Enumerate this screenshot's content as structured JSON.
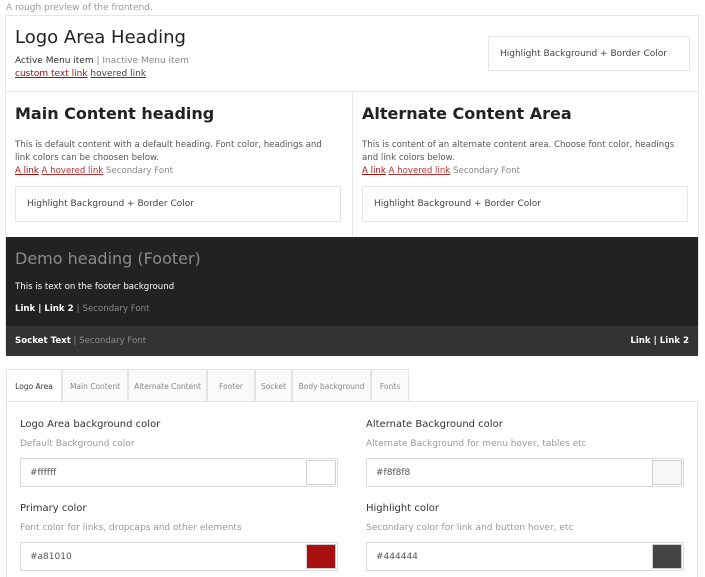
{
  "caption": "A rough preview of the frontend.",
  "logo_area": {
    "heading": "Logo Area Heading",
    "active_menu": "Active Menu item",
    "separator": "|",
    "inactive_menu": "Inactive Menu item",
    "custom_link": "custom text link",
    "hovered_link": "hovered link",
    "highlight_box": "Highlight Background + Border Color"
  },
  "main_content": {
    "heading": "Main Content heading",
    "text": "This is default content with a default heading. Font color, headings and link colors can be choosen below.",
    "link": "A link",
    "hovered_link": "A hovered link",
    "secondary": "Secondary Font",
    "highlight_box": "Highlight Background + Border Color"
  },
  "alternate_content": {
    "heading": "Alternate Content Area",
    "text": "This is content of an alternate content area. Choose font color, headings and link colors below.",
    "link": "A link",
    "hovered_link": "A hovered link",
    "secondary": "Secondary Font",
    "highlight_box": "Highlight Background + Border Color"
  },
  "footer": {
    "heading": "Demo heading (Footer)",
    "text": "This is text on the footer background",
    "link1": "Link",
    "sep": " | ",
    "link2": "Link 2",
    "secondary": "Secondary Font"
  },
  "socket": {
    "text": "Socket Text",
    "sep": " | ",
    "secondary": "Secondary Font",
    "links": "Link | Link 2"
  },
  "tabs": [
    "Logo Area",
    "Main Content",
    "Alternate Content",
    "Footer",
    "Socket",
    "Body background",
    "Fonts"
  ],
  "fields": [
    {
      "title": "Logo Area background color",
      "desc": "Default Background color",
      "value": "#ffffff",
      "color": "#ffffff"
    },
    {
      "title": "Alternate Background color",
      "desc": "Alternate Background for menu hover, tables etc",
      "value": "#f8f8f8",
      "color": "#f8f8f8"
    },
    {
      "title": "Primary color",
      "desc": "Font color for links, dropcaps and other elements",
      "value": "#a81010",
      "color": "#a81010"
    },
    {
      "title": "Highlight color",
      "desc": "Secondary color for link and button hover, etc",
      "value": "#444444",
      "color": "#444444"
    }
  ]
}
